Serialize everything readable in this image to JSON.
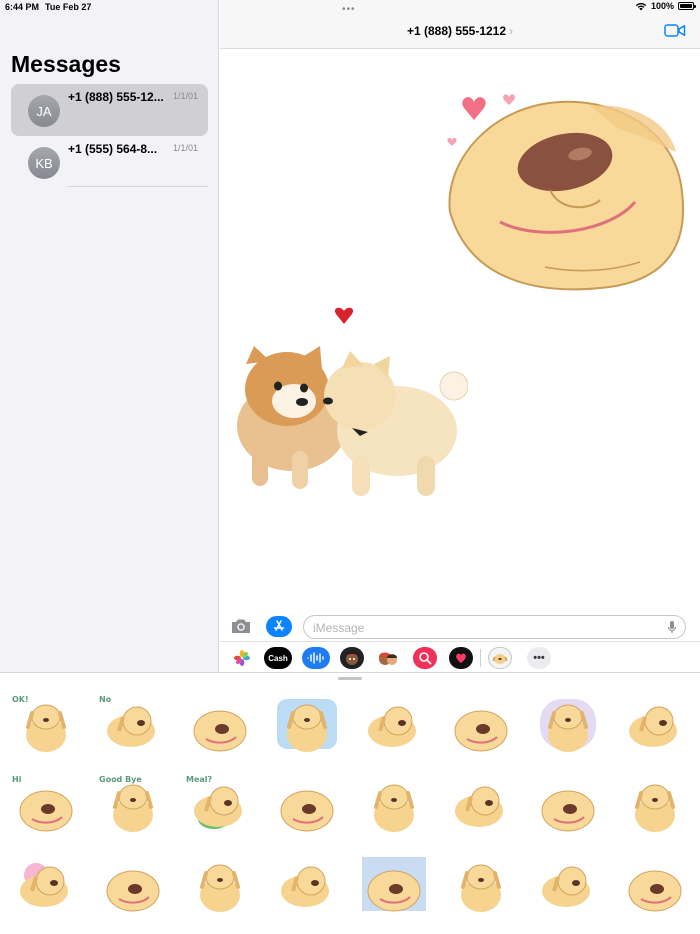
{
  "status_bar": {
    "time": "6:44 PM",
    "date": "Tue Feb 27",
    "battery": "100%",
    "battery_level": 1.0
  },
  "sidebar": {
    "title": "Messages",
    "conversations": [
      {
        "initials": "JA",
        "name": "+1 (888) 555-12...",
        "date": "1/1/01",
        "selected": true
      },
      {
        "initials": "KB",
        "name": "+1 (555) 564-8...",
        "date": "1/1/01",
        "selected": false
      }
    ]
  },
  "conversation": {
    "contact": "+1 (888) 555-1212",
    "multitask_dots": "•••"
  },
  "composer": {
    "placeholder": "iMessage",
    "apps": [
      {
        "name": "photos-app-icon",
        "label": ""
      },
      {
        "name": "apple-cash-app-icon",
        "label": "Cash"
      },
      {
        "name": "audio-message-app-icon",
        "label": ""
      },
      {
        "name": "memoji-app-icon",
        "label": ""
      },
      {
        "name": "memoji-stickers-app-icon",
        "label": ""
      },
      {
        "name": "image-search-app-icon",
        "label": ""
      },
      {
        "name": "digital-touch-app-icon",
        "label": ""
      },
      {
        "name": "dog-sticker-app-icon",
        "label": ""
      },
      {
        "name": "more-apps-icon",
        "label": "•••"
      }
    ]
  },
  "stickers": {
    "captions": [
      "OK!",
      "No",
      "",
      "",
      "",
      "",
      "",
      "",
      "Hi",
      "Good Bye",
      "Meal?",
      "",
      "",
      "",
      "",
      "",
      "",
      "",
      "",
      "",
      "",
      "",
      "",
      ""
    ]
  }
}
